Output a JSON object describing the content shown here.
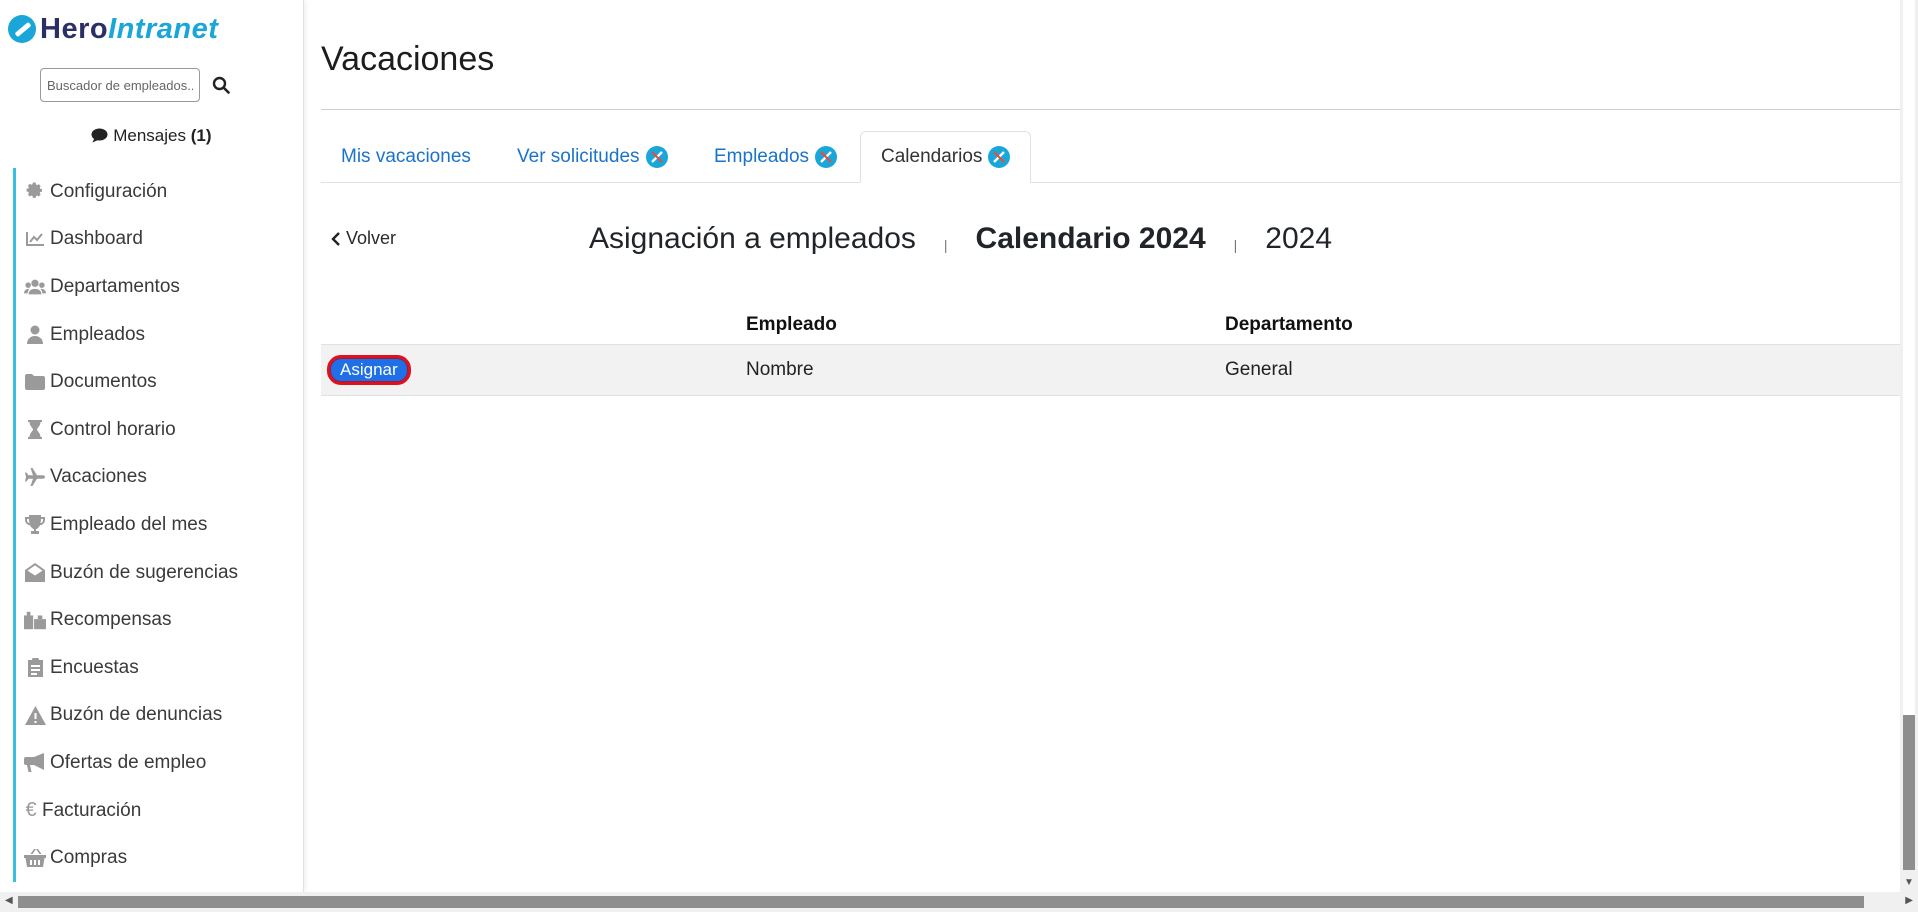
{
  "brand": {
    "hero": "Hero",
    "intranet": "Intranet"
  },
  "search": {
    "placeholder": "Buscador de empleados..."
  },
  "messages": {
    "label": "Mensajes",
    "count": "(1)"
  },
  "sidebar": {
    "items": [
      {
        "label": "Configuración",
        "icon": "gear-icon"
      },
      {
        "label": "Dashboard",
        "icon": "chart-line-icon"
      },
      {
        "label": "Departamentos",
        "icon": "users-icon"
      },
      {
        "label": "Empleados",
        "icon": "user-icon"
      },
      {
        "label": "Documentos",
        "icon": "folder-icon"
      },
      {
        "label": "Control horario",
        "icon": "hourglass-icon"
      },
      {
        "label": "Vacaciones",
        "icon": "plane-icon"
      },
      {
        "label": "Empleado del mes",
        "icon": "trophy-icon"
      },
      {
        "label": "Buzón de sugerencias",
        "icon": "envelope-open-icon"
      },
      {
        "label": "Recompensas",
        "icon": "gifts-icon"
      },
      {
        "label": "Encuestas",
        "icon": "clipboard-icon"
      },
      {
        "label": "Buzón de denuncias",
        "icon": "warning-icon"
      },
      {
        "label": "Ofertas de empleo",
        "icon": "megaphone-icon"
      },
      {
        "label": "Facturación",
        "icon": "euro-icon"
      },
      {
        "label": "Compras",
        "icon": "basket-icon"
      }
    ]
  },
  "page": {
    "title": "Vacaciones"
  },
  "tabs": [
    {
      "label": "Mis vacaciones"
    },
    {
      "label": "Ver solicitudes"
    },
    {
      "label": "Empleados"
    },
    {
      "label": "Calendarios"
    }
  ],
  "back": {
    "label": "Volver"
  },
  "heading": {
    "section": "Asignación a empleados",
    "calendar": "Calendario 2024",
    "year": "2024"
  },
  "table": {
    "headers": {
      "employee": "Empleado",
      "department": "Departamento"
    },
    "rows": [
      {
        "action": "Asignar",
        "employee": "Nombre",
        "department": "General"
      }
    ]
  },
  "colors": {
    "accent": "#1aa6d9",
    "link": "#1a73c9",
    "button": "#1e6fe8",
    "highlight": "#e0111f"
  }
}
